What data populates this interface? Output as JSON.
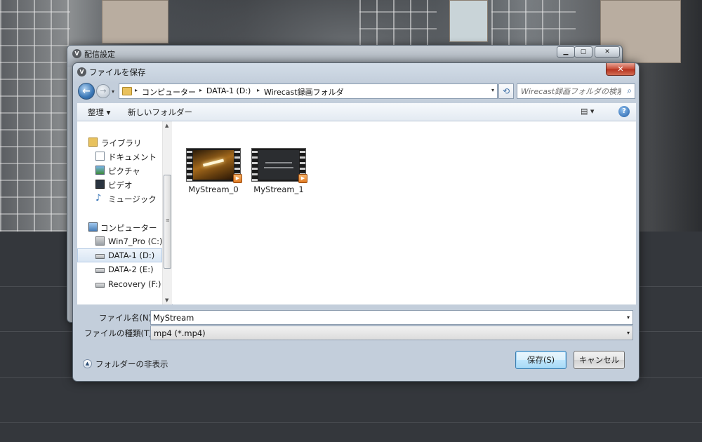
{
  "parent_window": {
    "title": "配信設定",
    "app_icon_glyph": "V",
    "controls": [
      "▁",
      "▢",
      "✕"
    ]
  },
  "dialog": {
    "title": "ファイルを保存",
    "app_icon_glyph": "V",
    "close_glyph": "✕"
  },
  "address_bar": {
    "back_glyph": "←",
    "forward_glyph": "→",
    "history_glyph": "▾",
    "crumbs": [
      "コンピューター",
      "DATA-1 (D:)",
      "Wirecast録画フォルダ"
    ],
    "crumb_separator": "▸",
    "dropdown_glyph": "▾",
    "refresh_glyph": "⟲",
    "search_placeholder": "Wirecast録画フォルダの検索",
    "search_glyph": "⌕"
  },
  "toolbar": {
    "organize_label": "整理 ▾",
    "new_folder_label": "新しいフォルダー",
    "view_glyph": "▤ ▾",
    "help_glyph": "?"
  },
  "nav_pane": {
    "items": [
      {
        "label": "ライブラリ",
        "icon": "library-icon",
        "indent": 0
      },
      {
        "label": "ドキュメント",
        "icon": "documents-icon",
        "indent": 1
      },
      {
        "label": "ピクチャ",
        "icon": "pictures-icon",
        "indent": 1
      },
      {
        "label": "ビデオ",
        "icon": "videos-icon",
        "indent": 1
      },
      {
        "label": "ミュージック",
        "icon": "music-icon",
        "indent": 1
      },
      {
        "label": "コンピューター",
        "icon": "computer-icon",
        "indent": 0
      },
      {
        "label": "Win7_Pro (C:)",
        "icon": "system-drive-icon",
        "indent": 1
      },
      {
        "label": "DATA-1 (D:)",
        "icon": "drive-icon",
        "indent": 1,
        "selected": true
      },
      {
        "label": "DATA-2 (E:)",
        "icon": "drive-icon",
        "indent": 1
      },
      {
        "label": "Recovery (F:)",
        "icon": "drive-icon",
        "indent": 1
      }
    ],
    "scroll_up_glyph": "▲",
    "scroll_down_glyph": "▼",
    "scroll_grip_glyph": "≡"
  },
  "files": [
    {
      "name": "MyStream_0",
      "thumbnail": "warm-ceiling-light",
      "play_glyph": "▶"
    },
    {
      "name": "MyStream_1",
      "thumbnail": "dark-text-screen",
      "play_glyph": "▶"
    }
  ],
  "form": {
    "filename_label": "ファイル名(N):",
    "filename_value": "MyStream",
    "filetype_label": "ファイルの種類(T):",
    "filetype_value": "mp4 (*.mp4)",
    "dropdown_glyph": "▾"
  },
  "footer": {
    "hide_folders_glyph": "▲",
    "hide_folders_label": "フォルダーの非表示",
    "save_label": "保存(S)",
    "cancel_label": "キャンセル"
  },
  "colors": {
    "dialog_frame": "#c3cedb",
    "close_button": "#c74a35",
    "save_button_border": "#3c7fb1",
    "selected_nav_bg": "#d9e6f4"
  }
}
